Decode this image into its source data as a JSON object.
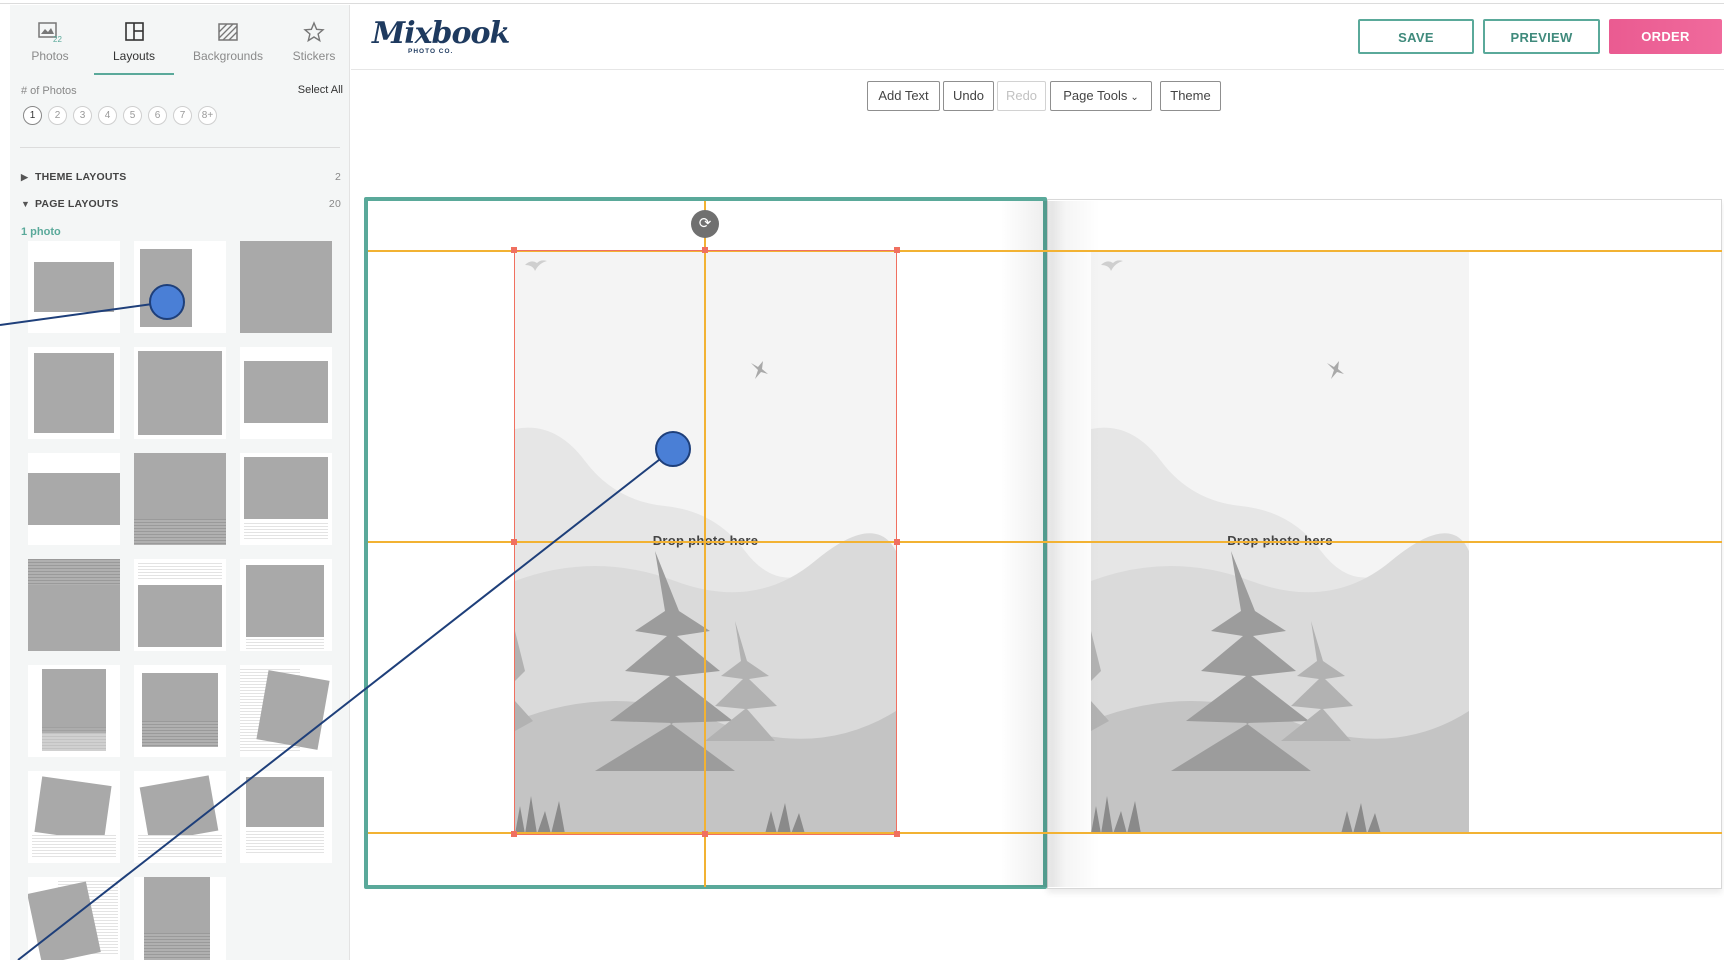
{
  "sidebar": {
    "tabs": [
      {
        "label": "Photos",
        "icon": "photos-icon",
        "badge": "22"
      },
      {
        "label": "Layouts",
        "icon": "layouts-icon",
        "active": true
      },
      {
        "label": "Backgrounds",
        "icon": "backgrounds-icon"
      },
      {
        "label": "Stickers",
        "icon": "star-icon"
      }
    ],
    "photos_count_label": "# of Photos",
    "select_all": "Select All",
    "counts": [
      "1",
      "2",
      "3",
      "4",
      "5",
      "6",
      "7",
      "8+"
    ],
    "sections": [
      {
        "label": "THEME LAYOUTS",
        "count": "2",
        "expanded": false
      },
      {
        "label": "PAGE LAYOUTS",
        "count": "20",
        "expanded": true
      }
    ],
    "group_label": "1 photo"
  },
  "header": {
    "logo_text": "Mixbook",
    "logo_sub": "PHOTO CO.",
    "save_label": "SAVE",
    "preview_label": "PREVIEW",
    "order_label": "ORDER"
  },
  "toolbar": {
    "add_text": "Add Text",
    "undo": "Undo",
    "redo": "Redo",
    "page_tools": "Page Tools",
    "theme": "Theme"
  },
  "canvas": {
    "left_page_drop_text": "Drop photo here",
    "right_page_drop_text": "Drop photo here"
  },
  "colors": {
    "accent": "#5aa99a",
    "order": "#ea5b91",
    "guide": "#f2b233",
    "selection": "#f07060",
    "logo": "#1e3a5f"
  }
}
